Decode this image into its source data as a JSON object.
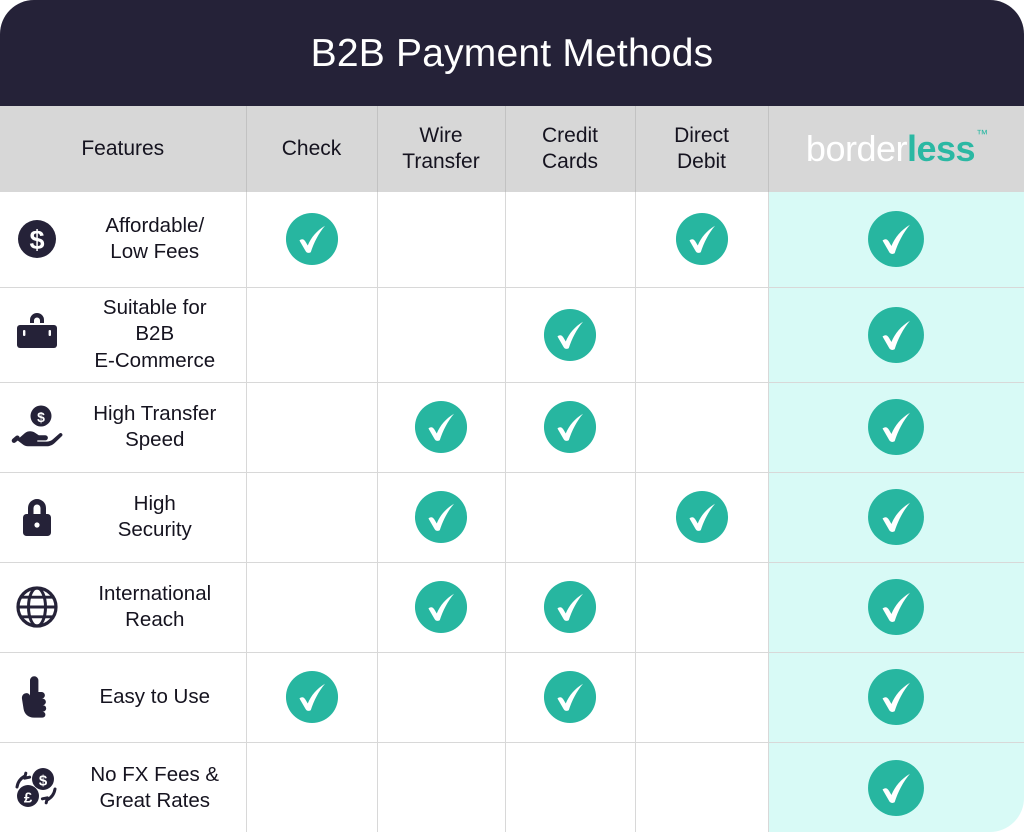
{
  "header": {
    "title": "B2B Payment Methods",
    "bg_color": "#252238",
    "title_color": "#ffffff"
  },
  "theme": {
    "accent_teal": "#2bb8a3",
    "check_circle": "#27b6a0",
    "brand_column_bg": "#d8faf6",
    "header_row_bg": "#d7d7d7",
    "dark_navy": "#252238",
    "grid_line": "#d8d8d8"
  },
  "table": {
    "columns": [
      {
        "id": "features",
        "label": "Features",
        "highlight": false
      },
      {
        "id": "check",
        "label": "Check",
        "highlight": false
      },
      {
        "id": "wire_transfer",
        "label": "Wire\nTransfer",
        "line1": "Wire",
        "line2": "Transfer",
        "highlight": false
      },
      {
        "id": "credit_cards",
        "label": "Credit\nCards",
        "line1": "Credit",
        "line2": "Cards",
        "highlight": false
      },
      {
        "id": "direct_debit",
        "label": "Direct\nDebit",
        "line1": "Direct",
        "line2": "Debit",
        "highlight": false
      },
      {
        "id": "borderless",
        "label": "borderless",
        "logo_part1": "border",
        "logo_part2": "less",
        "logo_tm": "™",
        "highlight": true
      }
    ],
    "rows": [
      {
        "icon": "dollar-circle-icon",
        "feature_line1": "Affordable/",
        "feature_line2": "Low Fees",
        "feature_line3": "",
        "values": [
          true,
          false,
          false,
          true,
          true
        ]
      },
      {
        "icon": "briefcase-icon",
        "feature_line1": "Suitable for",
        "feature_line2": "B2B",
        "feature_line3": "E-Commerce",
        "values": [
          false,
          false,
          true,
          false,
          true
        ]
      },
      {
        "icon": "hand-holding-coin-icon",
        "feature_line1": "High Transfer",
        "feature_line2": "Speed",
        "feature_line3": "",
        "values": [
          false,
          true,
          true,
          false,
          true
        ]
      },
      {
        "icon": "padlock-icon",
        "feature_line1": "High",
        "feature_line2": "Security",
        "feature_line3": "",
        "values": [
          false,
          true,
          false,
          true,
          true
        ]
      },
      {
        "icon": "globe-icon",
        "feature_line1": "International",
        "feature_line2": "Reach",
        "feature_line3": "",
        "values": [
          false,
          true,
          true,
          false,
          true
        ]
      },
      {
        "icon": "pointing-finger-icon",
        "feature_line1": "Easy to Use",
        "feature_line2": "",
        "feature_line3": "",
        "values": [
          true,
          false,
          true,
          false,
          true
        ]
      },
      {
        "icon": "currency-exchange-icon",
        "feature_line1": "No FX Fees &",
        "feature_line2": "Great Rates",
        "feature_line3": "",
        "values": [
          false,
          false,
          false,
          false,
          true
        ]
      }
    ]
  }
}
